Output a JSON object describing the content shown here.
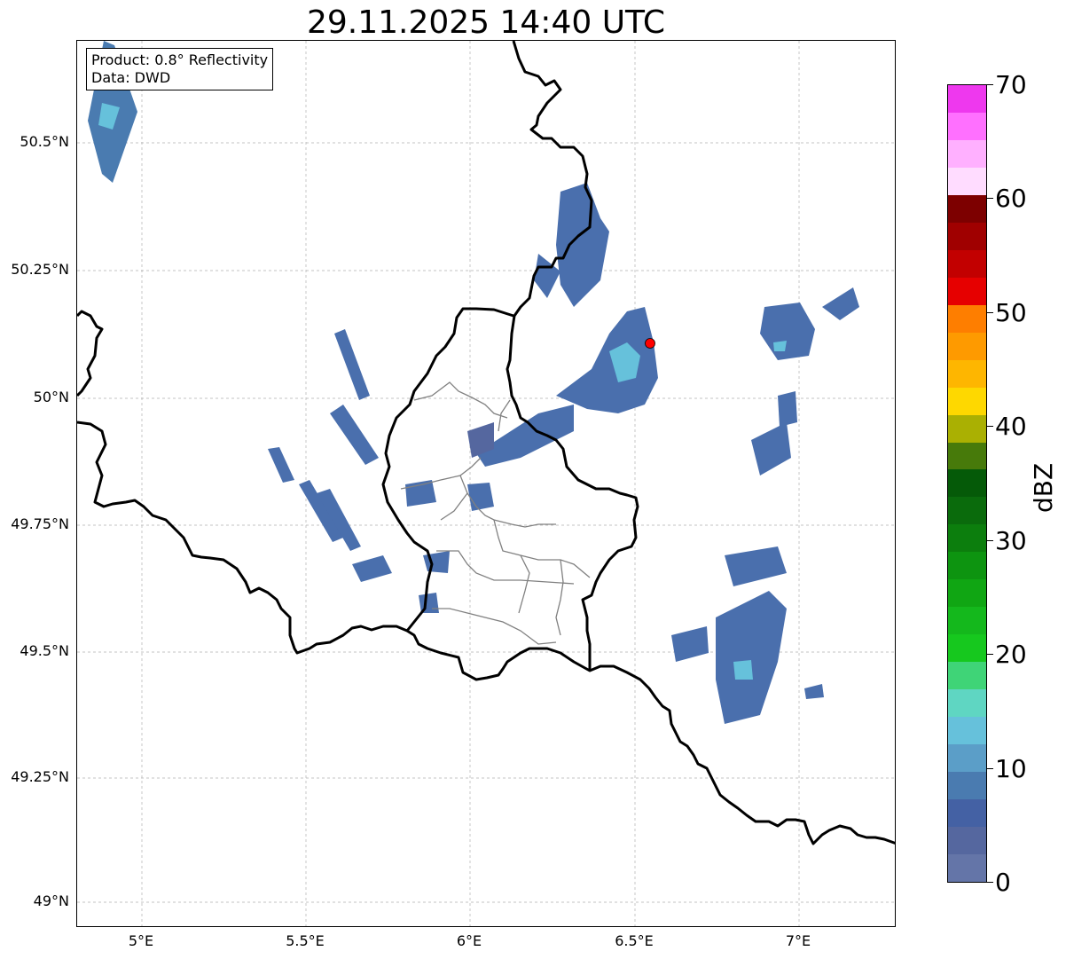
{
  "title": "29.11.2025 14:40 UTC",
  "info_box": {
    "line1": "Product: 0.8° Reflectivity",
    "line2": "Data: DWD"
  },
  "chart_data": {
    "type": "heatmap",
    "title": "29.11.2025 14:40 UTC",
    "x_axis": {
      "unit": "longitude",
      "ticks": [
        "5°E",
        "5.5°E",
        "6°E",
        "6.5°E",
        "7°E"
      ],
      "range": [
        4.8,
        7.3
      ]
    },
    "y_axis": {
      "unit": "latitude",
      "ticks": [
        "50.5°N",
        "50.25°N",
        "50°N",
        "49.75°N",
        "49.5°N",
        "49.25°N",
        "49°N"
      ],
      "range": [
        48.95,
        50.7
      ]
    },
    "grid": true,
    "colorbar": {
      "label": "dBZ",
      "ticks": [
        "0",
        "10",
        "20",
        "30",
        "40",
        "50",
        "60",
        "70"
      ],
      "range": [
        0,
        70
      ],
      "colors": [
        "#6475a8",
        "#55679f",
        "#4461a4",
        "#4a7bb0",
        "#5b9ec8",
        "#66c1db",
        "#5fd6c2",
        "#3fd477",
        "#16c81e",
        "#14b81c",
        "#10a613",
        "#0d9410",
        "#0c7e0d",
        "#0a6b0c",
        "#055a08",
        "#477a0a",
        "#aab002",
        "#fed800",
        "#feb600",
        "#fe9a00",
        "#fe7e00",
        "#e60000",
        "#c20000",
        "#a00000",
        "#7d0000",
        "#ffdcff",
        "#ffb0ff",
        "#ff70ff",
        "#ee38ee"
      ]
    },
    "radar_site": {
      "lon": 6.55,
      "lat": 50.11,
      "color": "#ff0000"
    },
    "echo_clusters": [
      {
        "lon": 4.9,
        "lat": 50.58,
        "dbz": 10
      },
      {
        "lon": 6.48,
        "lat": 50.05,
        "dbz": 12
      },
      {
        "lon": 6.35,
        "lat": 50.25,
        "dbz": 5
      },
      {
        "lon": 6.95,
        "lat": 50.13,
        "dbz": 8
      },
      {
        "lon": 5.5,
        "lat": 49.85,
        "dbz": 6
      },
      {
        "lon": 6.1,
        "lat": 49.92,
        "dbz": 7
      },
      {
        "lon": 6.85,
        "lat": 49.55,
        "dbz": 9
      },
      {
        "lon": 6.9,
        "lat": 49.85,
        "dbz": 6
      }
    ]
  }
}
